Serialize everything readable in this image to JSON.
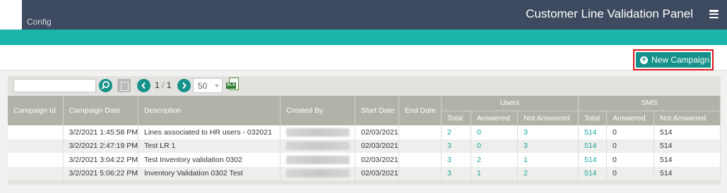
{
  "app": {
    "title": "Customer Line Validation Panel",
    "nav_label": "Config"
  },
  "actions": {
    "new_campaign_label": "New Campaign"
  },
  "toolbar": {
    "search_value": "",
    "pager_current": "1",
    "pager_total": "1",
    "page_size": "50",
    "export_label": "XLS"
  },
  "table": {
    "headers": {
      "campaign_id": "Campaign Id",
      "campaign_date": "Campaign Date",
      "description": "Description",
      "created_by": "Created By",
      "start_date": "Start Date",
      "end_date": "End Date",
      "users_group": "Users",
      "sms_group": "SMS",
      "users_total": "Total",
      "users_answered": "Answered",
      "users_not_answered": "Not Answered",
      "sms_total": "Total",
      "sms_answered": "Answered",
      "sms_not_answered": "Not Answered"
    },
    "rows": [
      {
        "campaign_id": "",
        "campaign_date": "3/2/2021 1:45:58 PM",
        "description": "Lines associated to HR users - 032021",
        "created_by": "",
        "start_date": "02/03/2021",
        "end_date": "",
        "users_total": "2",
        "users_answered": "0",
        "users_not_answered": "3",
        "sms_total": "514",
        "sms_answered": "0",
        "sms_not_answered": "514"
      },
      {
        "campaign_id": "",
        "campaign_date": "3/2/2021 2:47:19 PM",
        "description": "Test LR 1",
        "created_by": "",
        "start_date": "02/03/2021",
        "end_date": "",
        "users_total": "3",
        "users_answered": "0",
        "users_not_answered": "3",
        "sms_total": "514",
        "sms_answered": "0",
        "sms_not_answered": "514"
      },
      {
        "campaign_id": "",
        "campaign_date": "3/2/2021 3:04:22 PM",
        "description": "Test Inventory validation 0302",
        "created_by": "",
        "start_date": "02/03/2021",
        "end_date": "",
        "users_total": "3",
        "users_answered": "2",
        "users_not_answered": "1",
        "sms_total": "514",
        "sms_answered": "0",
        "sms_not_answered": "514"
      },
      {
        "campaign_id": "",
        "campaign_date": "3/2/2021 5:06:22 PM",
        "description": "Inventory Validation 0302 Test",
        "created_by": "",
        "start_date": "02/03/2021",
        "end_date": "",
        "users_total": "3",
        "users_answered": "1",
        "users_not_answered": "2",
        "sms_total": "514",
        "sms_answered": "0",
        "sms_not_answered": "514"
      }
    ]
  },
  "colors": {
    "topbar": "#3e4a5f",
    "accent": "#1bb5ac",
    "button": "#16928a",
    "highlight": "#e0141b",
    "header": "#b2b2a8"
  }
}
